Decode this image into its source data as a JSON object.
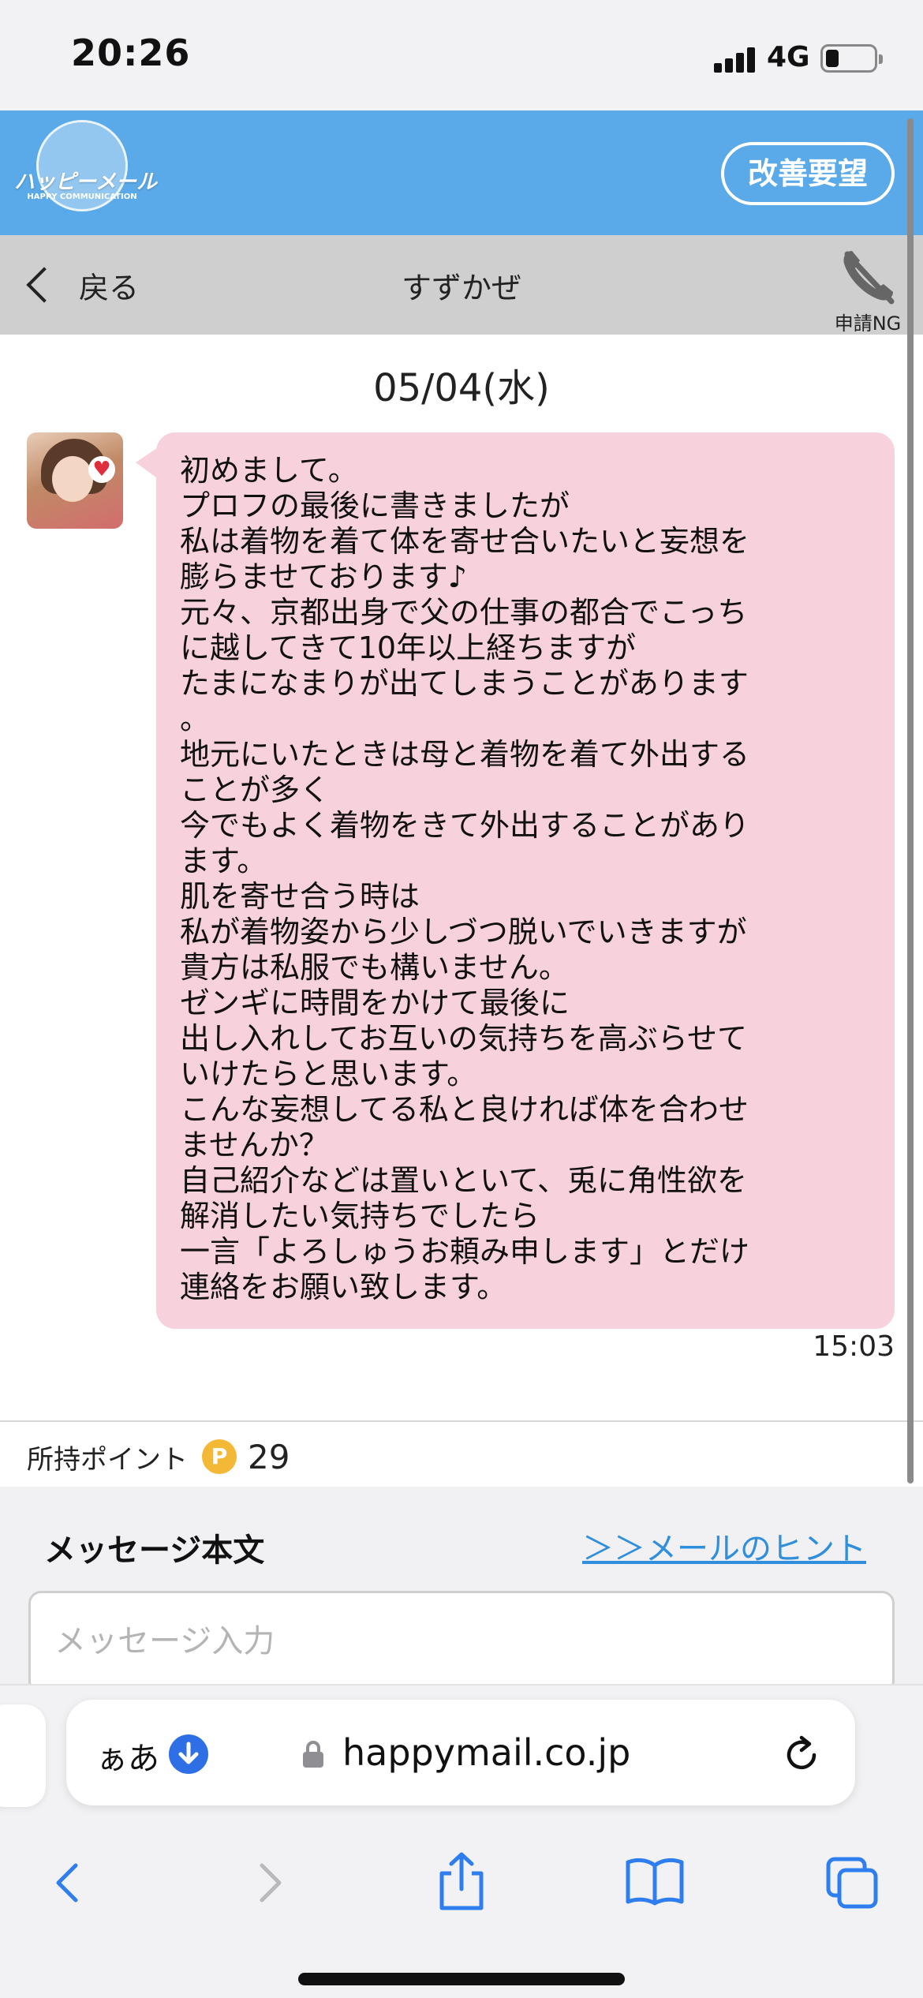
{
  "status_bar": {
    "time": "20:26",
    "network": "4G"
  },
  "app_header": {
    "logo_text": "ハッピーメール",
    "logo_subtitle": "HAPPY COMMUNICATION",
    "feedback_button": "改善要望"
  },
  "nav": {
    "back_label": "戻る",
    "title": "すずかぜ",
    "ng_label": "申請NG"
  },
  "conversation": {
    "date": "05/04(水)",
    "message_lines": [
      "初めまして。",
      "プロフの最後に書きましたが",
      "私は着物を着て体を寄せ合いたいと妄想を",
      "膨らませております♪",
      "元々、京都出身で父の仕事の都合でこっち",
      "に越してきて10年以上経ちますが",
      "たまになまりが出てしまうことがあります",
      "。",
      "地元にいたときは母と着物を着て外出する",
      "ことが多く",
      "今でもよく着物をきて外出することがあり",
      "ます。",
      "肌を寄せ合う時は",
      "私が着物姿から少しづつ脱いでいきますが",
      "貴方は私服でも構いません。",
      "ゼンギに時間をかけて最後に",
      "出し入れしてお互いの気持ちを高ぶらせて",
      "いけたらと思います。",
      "こんな妄想してる私と良ければ体を合わせ",
      "ませんか？",
      "自己紹介などは置いといて、兎に角性欲を",
      "解消したい気持ちでしたら",
      "一言「よろしゅうお頼み申します」とだけ",
      "連絡をお願い致します。"
    ],
    "time": "15:03"
  },
  "points": {
    "label": "所持ポイント",
    "icon_letter": "P",
    "value": "29"
  },
  "composer": {
    "title": "メッセージ本文",
    "hint_link": "＞＞メールのヒント",
    "placeholder": "メッセージ入力"
  },
  "browser": {
    "aa_label": "ぁあ",
    "url": "happymail.co.jp"
  },
  "colors": {
    "header_blue": "#5aa9e8",
    "bubble_pink": "#f7d1dc",
    "link_blue": "#2f8fdc",
    "point_gold": "#f3b836",
    "safari_blue": "#2f6fe6"
  }
}
